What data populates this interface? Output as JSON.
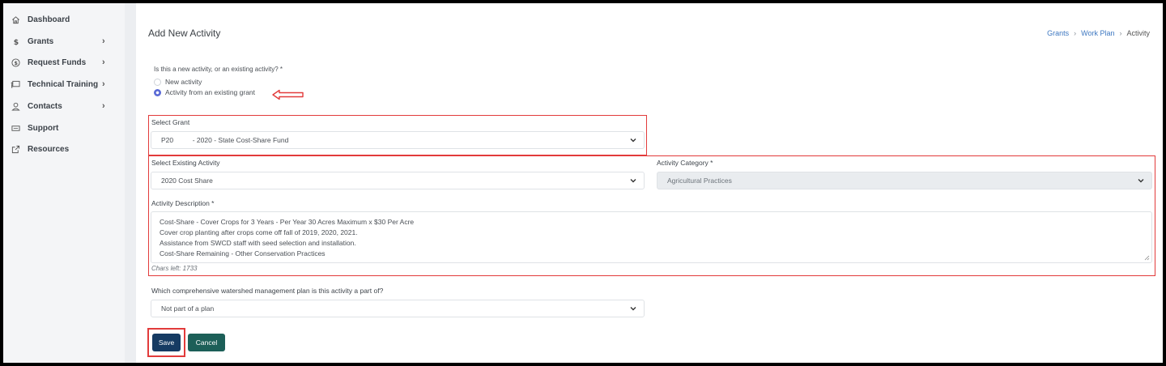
{
  "sidebar": {
    "items": [
      {
        "label": "Dashboard",
        "icon": "home-icon",
        "has_submenu": false
      },
      {
        "label": "Grants",
        "icon": "dollar-icon",
        "has_submenu": true
      },
      {
        "label": "Request Funds",
        "icon": "coin-icon",
        "has_submenu": true
      },
      {
        "label": "Technical Training",
        "icon": "presentation-icon",
        "has_submenu": true
      },
      {
        "label": "Contacts",
        "icon": "person-icon",
        "has_submenu": true
      },
      {
        "label": "Support",
        "icon": "ticket-icon",
        "has_submenu": false
      },
      {
        "label": "Resources",
        "icon": "external-link-icon",
        "has_submenu": false
      }
    ]
  },
  "header": {
    "title": "Add New Activity",
    "breadcrumb": [
      "Grants",
      "Work Plan",
      "Activity"
    ]
  },
  "form": {
    "activity_type_question": "Is this a new activity, or an existing activity? *",
    "activity_type_options": [
      {
        "label": "New activity",
        "checked": false
      },
      {
        "label": "Activity from an existing grant",
        "checked": true
      }
    ],
    "select_grant": {
      "label": "Select Grant",
      "value": "P20          - 2020 - State Cost-Share Fund"
    },
    "select_existing_activity": {
      "label": "Select Existing Activity",
      "value": "2020 Cost Share"
    },
    "activity_category": {
      "label": "Activity Category *",
      "value": "Agricultural Practices"
    },
    "activity_description": {
      "label": "Activity Description *",
      "lines": [
        "Cost-Share - Cover Crops for 3 Years - Per Year 30 Acres Maximum x $30 Per Acre",
        "Cover crop planting after crops come off fall of 2019, 2020, 2021.",
        "Assistance from SWCD staff with seed selection and installation.",
        "Cost-Share Remaining - Other Conservation Practices"
      ],
      "chars_left": "Chars left: 1733"
    },
    "watershed_plan": {
      "label": "Which comprehensive watershed management plan is this activity a part of?",
      "value": "Not part of a plan"
    },
    "save_label": "Save",
    "cancel_label": "Cancel"
  },
  "colors": {
    "annotation_red": "#e23b3b",
    "save_button": "#163b63",
    "cancel_button": "#1c5f58",
    "link_blue": "#3e78c1",
    "radio_accent": "#5b6bd6"
  }
}
